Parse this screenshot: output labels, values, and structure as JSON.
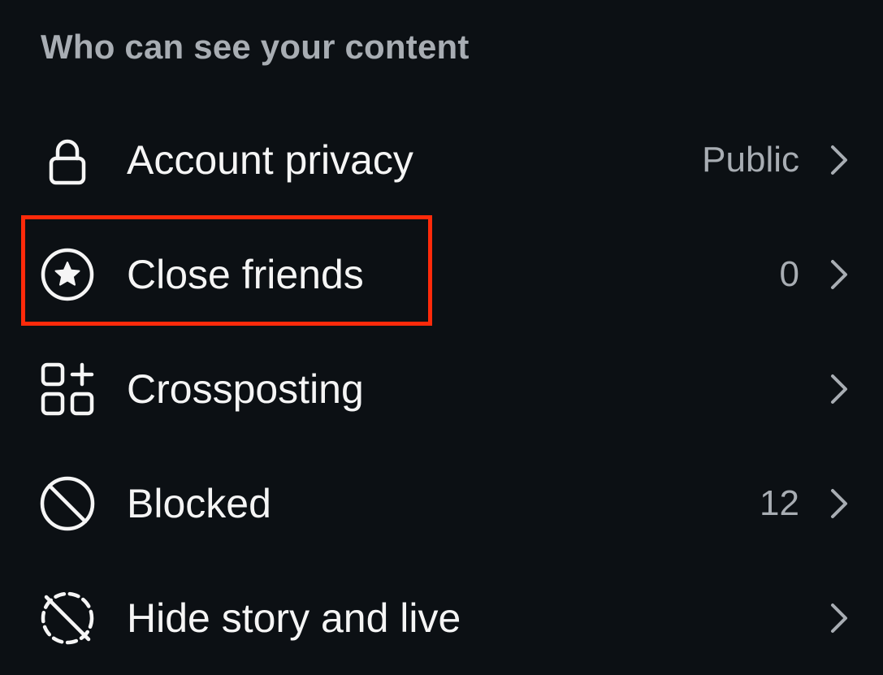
{
  "section": {
    "title": "Who can see your content"
  },
  "items": [
    {
      "label": "Account privacy",
      "value": "Public",
      "icon": "lock-icon"
    },
    {
      "label": "Close friends",
      "value": "0",
      "icon": "star-circle-icon"
    },
    {
      "label": "Crossposting",
      "value": "",
      "icon": "grid-plus-icon"
    },
    {
      "label": "Blocked",
      "value": "12",
      "icon": "block-icon"
    },
    {
      "label": "Hide story and live",
      "value": "",
      "icon": "hide-story-icon"
    }
  ],
  "highlight": {
    "target": "Close friends",
    "color": "#ff2a0a"
  },
  "colors": {
    "background": "#0c1014",
    "primary_text": "#f5f5f5",
    "secondary_text": "#a8adb3"
  }
}
